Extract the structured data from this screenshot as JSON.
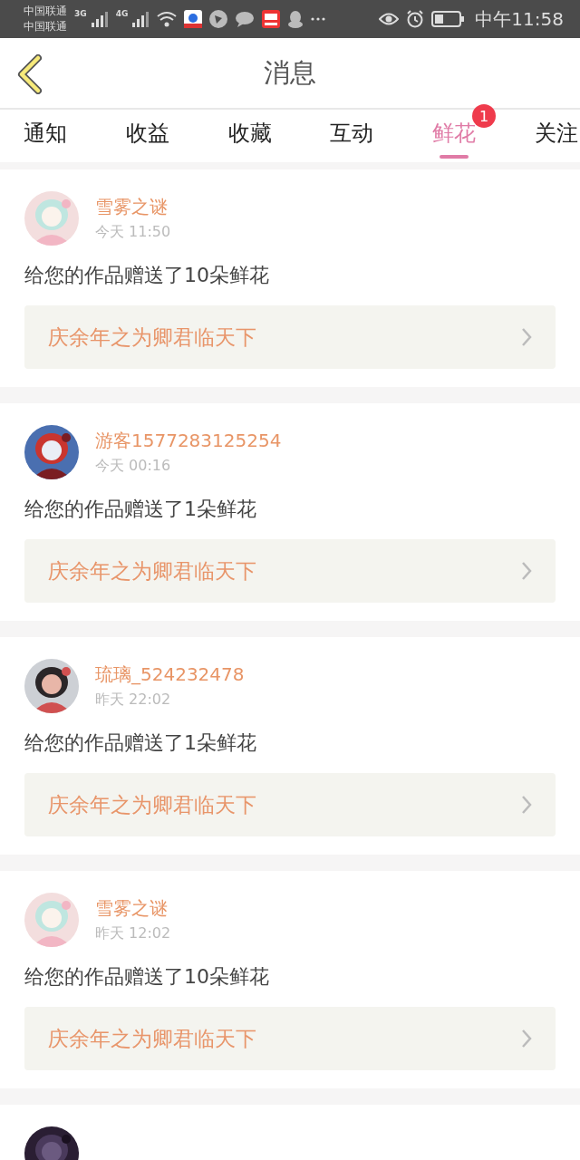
{
  "status_bar": {
    "carriers": [
      "中国联通",
      "中国联通"
    ],
    "networks": [
      "3G",
      "4G"
    ],
    "time": "中午11:58"
  },
  "header": {
    "title": "消息"
  },
  "tabs": [
    {
      "label": "通知",
      "selected": false
    },
    {
      "label": "收益",
      "selected": false
    },
    {
      "label": "收藏",
      "selected": false
    },
    {
      "label": "互动",
      "selected": false
    },
    {
      "label": "鲜花",
      "selected": true,
      "badge": "1"
    },
    {
      "label": "关注",
      "selected": false
    }
  ],
  "messages": [
    {
      "user": "雪雾之谜",
      "time": "今天 11:50",
      "text": "给您的作品赠送了10朵鲜花",
      "book": "庆余年之为卿君临天下",
      "avatar": {
        "kind": "picture"
      }
    },
    {
      "user": "游客1577283125254",
      "time": "今天 00:16",
      "text": "给您的作品赠送了1朵鲜花",
      "book": "庆余年之为卿君临天下",
      "avatar": {
        "kind": "picture"
      }
    },
    {
      "user": "琉璃_524232478",
      "time": "昨天 22:02",
      "text": "给您的作品赠送了1朵鲜花",
      "book": "庆余年之为卿君临天下",
      "avatar": {
        "kind": "picture"
      }
    },
    {
      "user": "雪雾之谜",
      "time": "昨天 12:02",
      "text": "给您的作品赠送了10朵鲜花",
      "book": "庆余年之为卿君临天下",
      "avatar": {
        "kind": "picture"
      }
    },
    {
      "avatar": {
        "kind": "picture"
      }
    }
  ]
}
